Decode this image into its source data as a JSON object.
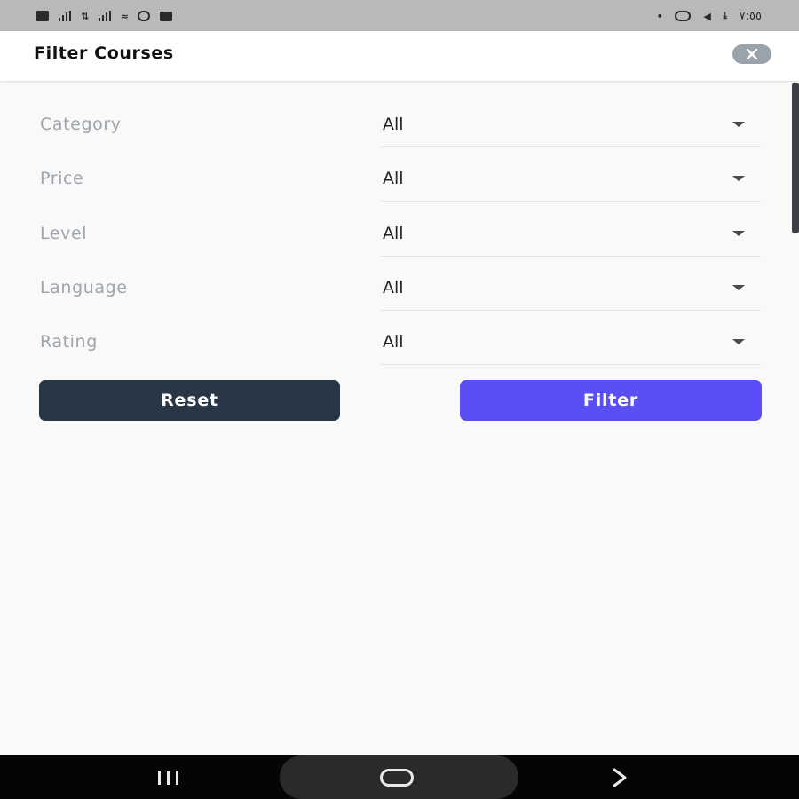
{
  "status_bar": {
    "time": "٧:٥٥",
    "icons_left": [
      "sim-icon",
      "signal-icon",
      "data-icon",
      "signal-icon",
      "wifi-icon",
      "settings-icon",
      "camera-icon"
    ],
    "icons_right": [
      "dot-icon",
      "whatsapp-icon",
      "telegram-icon",
      "download-icon"
    ]
  },
  "header": {
    "title": "Filter Courses",
    "close_icon": "close-icon"
  },
  "filters": [
    {
      "label": "Category",
      "value": "All"
    },
    {
      "label": "Price",
      "value": "All"
    },
    {
      "label": "Level",
      "value": "All"
    },
    {
      "label": "Language",
      "value": "All"
    },
    {
      "label": "Rating",
      "value": "All"
    }
  ],
  "buttons": {
    "reset": "Reset",
    "filter": "Filter"
  },
  "colors": {
    "reset_button": "#283646",
    "filter_button": "#594ff4",
    "label_text": "#9ea4ab"
  },
  "nav_bar": {
    "icons": [
      "recents-icon",
      "home-icon",
      "back-icon"
    ]
  }
}
